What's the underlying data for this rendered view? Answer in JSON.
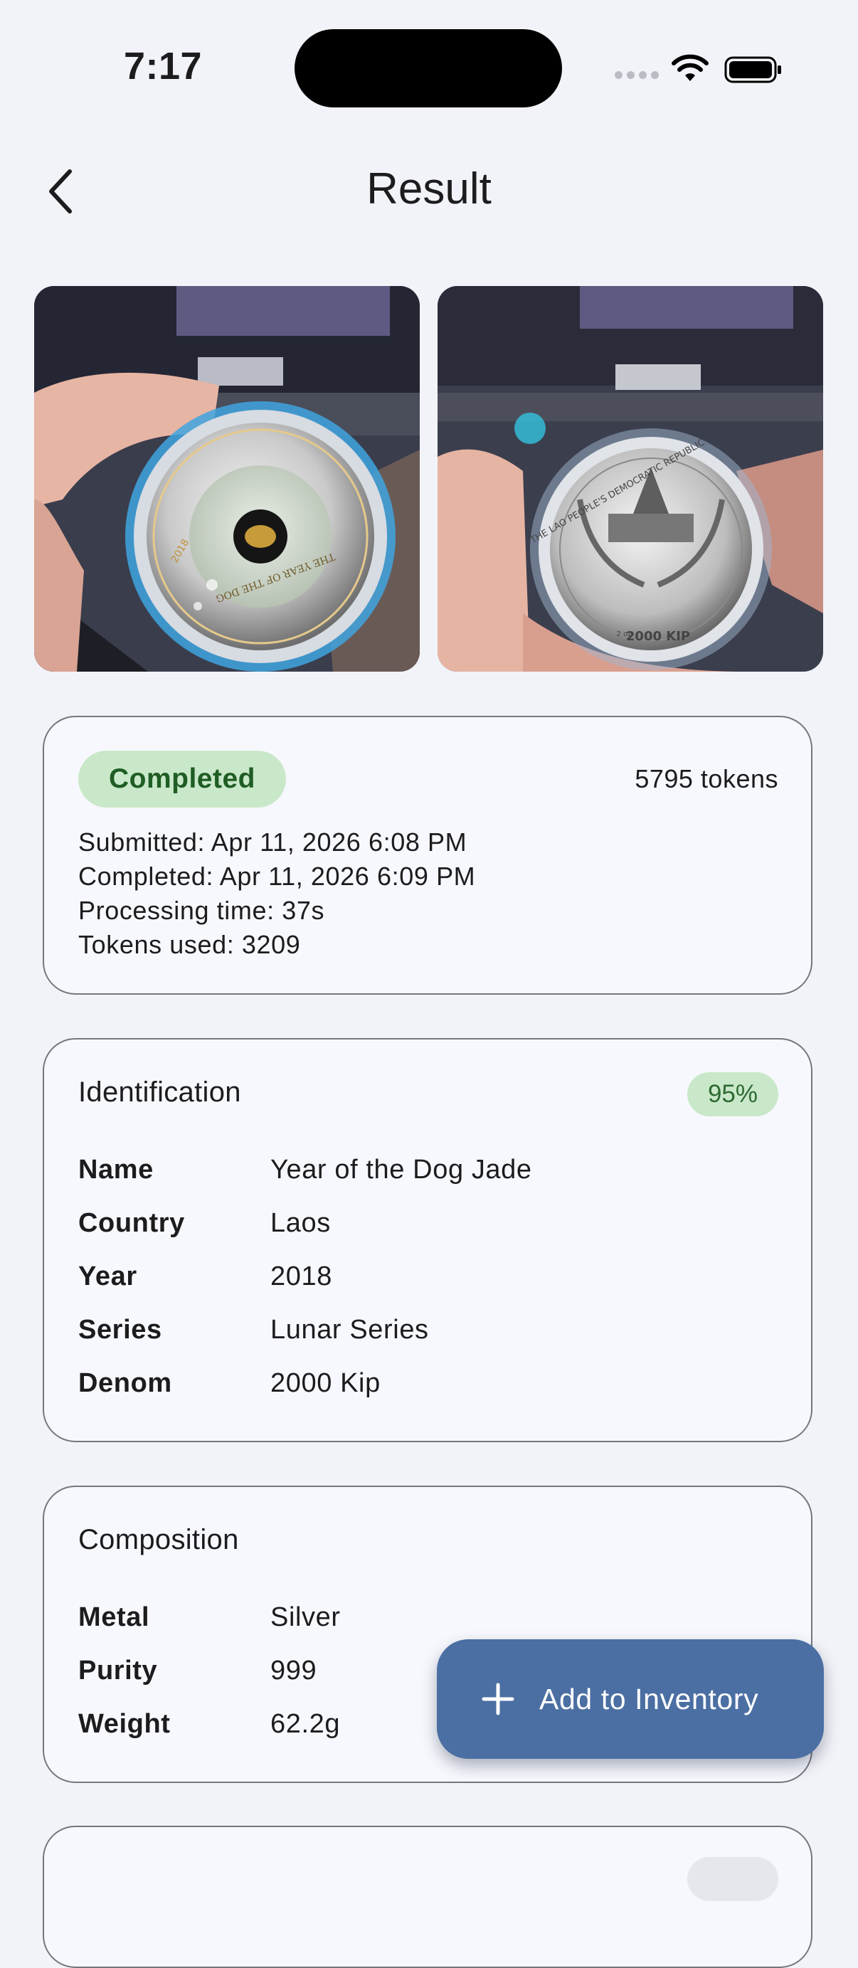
{
  "status_bar": {
    "time": "7:17"
  },
  "header": {
    "title": "Result"
  },
  "images": [
    {
      "label": "coin-obverse-photo"
    },
    {
      "label": "coin-reverse-photo"
    }
  ],
  "coin_text": {
    "obverse": "THE YEAR OF THE DOG",
    "obverse_year": "2018",
    "reverse_top": "THE LAO PEOPLE'S DEMOCRATIC REPUBLIC",
    "reverse_weight": "2 oz",
    "reverse_value": "2000 KIP"
  },
  "status_card": {
    "status": "Completed",
    "tokens_total": "5795 tokens",
    "submitted": "Submitted: Apr 11, 2026 6:08 PM",
    "completed": "Completed: Apr 11, 2026 6:09 PM",
    "processing": "Processing time: 37s",
    "tokens_used": "Tokens used: 3209"
  },
  "identification": {
    "title": "Identification",
    "confidence": "95%",
    "rows": [
      {
        "label": "Name",
        "value": "Year of the Dog Jade"
      },
      {
        "label": "Country",
        "value": "Laos"
      },
      {
        "label": "Year",
        "value": "2018"
      },
      {
        "label": "Series",
        "value": "Lunar Series"
      },
      {
        "label": "Denom",
        "value": "2000 Kip"
      }
    ]
  },
  "composition": {
    "title": "Composition",
    "rows": [
      {
        "label": "Metal",
        "value": "Silver"
      },
      {
        "label": "Purity",
        "value": "999"
      },
      {
        "label": "Weight",
        "value": "62.2g"
      }
    ]
  },
  "fab": {
    "label": "Add to Inventory"
  },
  "colors": {
    "background": "#f2f3f8",
    "accent": "#4b6fa3",
    "success_bg": "#c9e8c9",
    "success_text": "#1f5d24"
  }
}
